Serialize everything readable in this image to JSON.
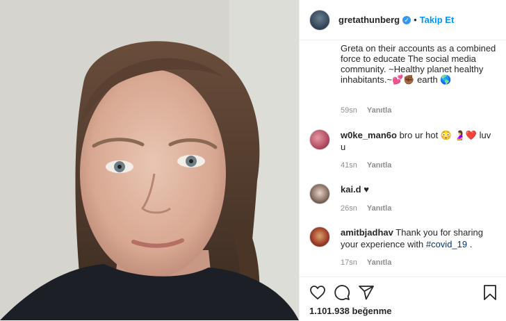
{
  "post": {
    "photo_alt": "",
    "header": {
      "username": "gretathunberg",
      "verified_glyph": "✓",
      "dot": "•",
      "follow_label": "Takip Et"
    },
    "caption_continuation": "Greta on their accounts as a combined force to educate The social media community. ~Healthy planet healthy inhabitants.~💕✊🏾 earth 🌎",
    "caption_meta": {
      "time": "59sn",
      "reply": "Yanıtla"
    },
    "comments": [
      {
        "username": "w0ke_man6o",
        "text": "bro ur hot 😳 🤰❤️ luv u",
        "time": "41sn",
        "reply": "Yanıtla"
      },
      {
        "username": "kai.d",
        "text": "♥",
        "time": "26sn",
        "reply": "Yanıtla"
      },
      {
        "username": "amitbjadhav",
        "text": "Thank you for sharing your experience with ",
        "hashtag": "#covid_19",
        "text_end": " .",
        "time": "17sn",
        "reply": "Yanıtla"
      }
    ],
    "likes_text": "1.101.938 beğenme",
    "icons": [
      "heart-icon",
      "comment-icon",
      "share-icon",
      "bookmark-icon"
    ]
  },
  "colors": {
    "accent": "#0095f6",
    "verified": "#3897f0",
    "meta": "#8e8e8e",
    "text": "#262626"
  }
}
